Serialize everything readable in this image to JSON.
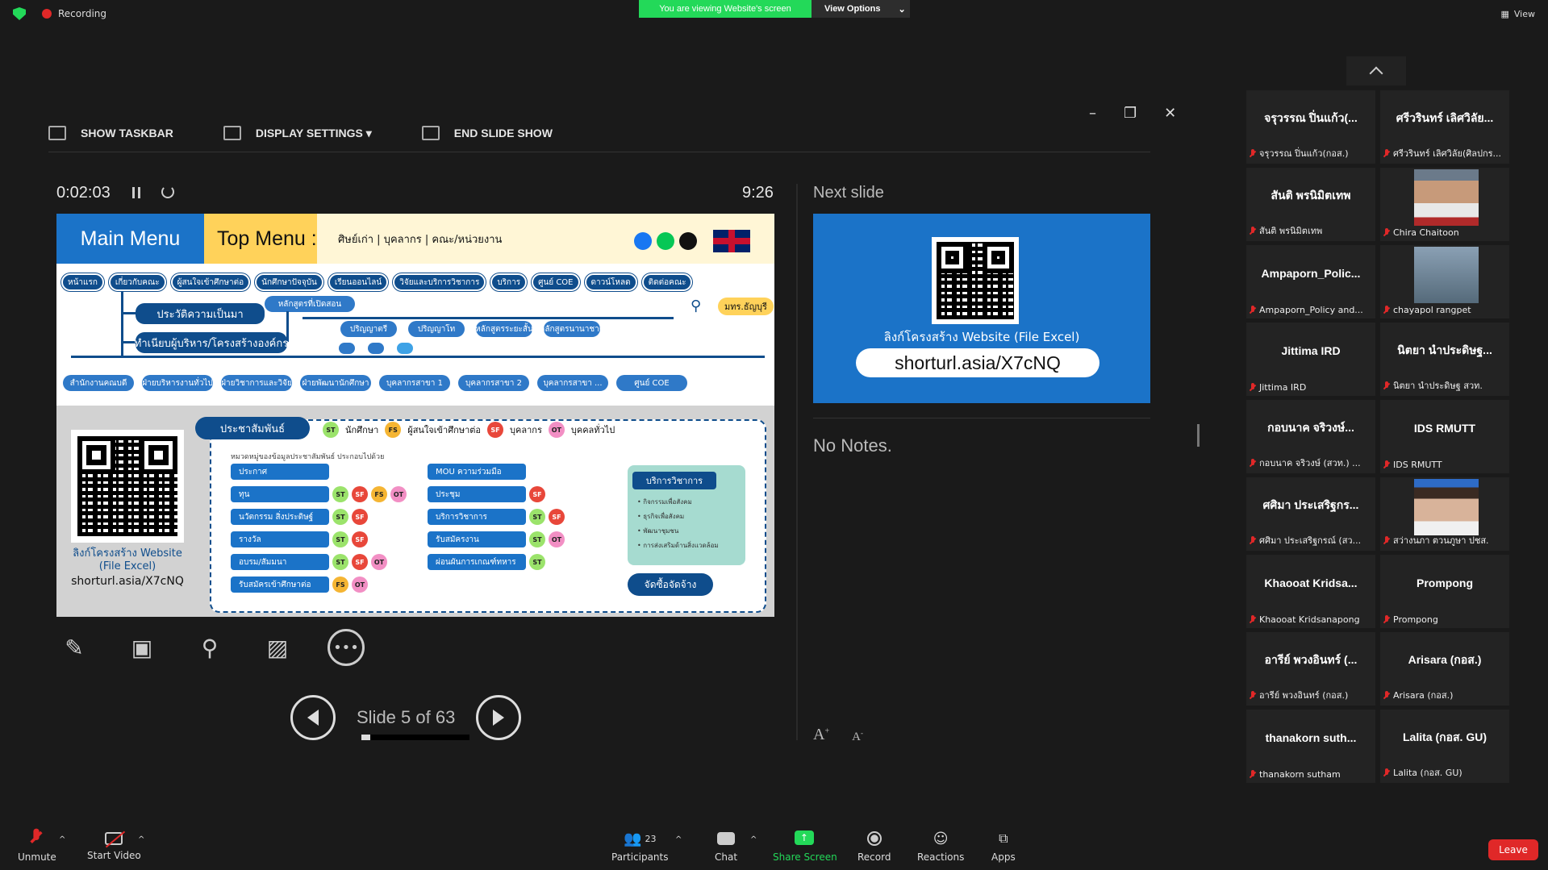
{
  "topbar": {
    "recording_label": "Recording",
    "viewing_banner": "You are viewing Website's screen",
    "view_options": "View Options",
    "view_label": "View"
  },
  "presenter": {
    "toolbar": {
      "show_taskbar": "SHOW TASKBAR",
      "display_settings": "DISPLAY SETTINGS ▾",
      "end_slide_show": "END SLIDE SHOW"
    },
    "timer": "0:02:03",
    "clock": "9:26",
    "slide_counter": "Slide 5 of 63",
    "progress_fraction": 0.079,
    "next_slide_label": "Next slide",
    "notes": "No Notes.",
    "font_increase": "A",
    "font_decrease": "A"
  },
  "slide": {
    "main_menu": "Main Menu",
    "top_menu": "Top Menu :",
    "top_links": "ศิษย์เก่า | บุคลากร | คณะ/หน่วยงาน",
    "nav": [
      "หน้าแรก",
      "เกี่ยวกับคณะ",
      "ผู้สนใจเข้าศึกษาต่อ",
      "นักศึกษาปัจจุบัน",
      "เรียนออนไลน์",
      "วิจัยและบริการวิชาการ",
      "บริการ",
      "ศูนย์ COE",
      "ดาวน์โหลด",
      "ติดต่อคณะ"
    ],
    "history": "ประวัติความเป็นมา",
    "courses": "หลักสูตรที่เปิดสอน",
    "course_levels": [
      "ปริญญาตรี",
      "ปริญญาโท",
      "หลักสูตรระยะสั้น",
      "หลักสูตรนานาชาติ"
    ],
    "admin": "ทำเนียบผู้บริหาร/โครงสร้างองค์กร",
    "units": [
      "สำนักงานคณบดี",
      "ฝ่ายบริหารงานทั่วไป",
      "ฝ่ายวิชาการและวิจัย",
      "ฝ่ายพัฒนานักศึกษา",
      "บุคลากรสาขา 1",
      "บุคลากรสาขา 2",
      "บุคลากรสาขา ...",
      "ศูนย์ COE"
    ],
    "campus_badge": "มทร.ธัญบุรี",
    "qr_caption": "ลิงก์โครงสร้าง Website (File Excel)",
    "qr_url": "shorturl.asia/X7cNQ",
    "pr_header": "ประชาสัมพันธ์",
    "legend": [
      {
        "code": "ST",
        "label": "นักศึกษา"
      },
      {
        "code": "FS",
        "label": "ผู้สนใจเข้าศึกษาต่อ"
      },
      {
        "code": "SF",
        "label": "บุคลากร"
      },
      {
        "code": "OT",
        "label": "บุคคลทั่วไป"
      }
    ],
    "pr_note": "หมวดหมู่ของข้อมูลประชาสัมพันธ์ ประกอบไปด้วย",
    "categories_left": [
      {
        "label": "ประกาศ",
        "badges": []
      },
      {
        "label": "ทุน",
        "badges": [
          "ST",
          "SF",
          "FS",
          "OT"
        ]
      },
      {
        "label": "นวัตกรรม สิ่งประดิษฐ์",
        "badges": [
          "ST",
          "SF"
        ]
      },
      {
        "label": "รางวัล",
        "badges": [
          "ST",
          "SF"
        ]
      },
      {
        "label": "อบรม/สัมมนา",
        "badges": [
          "ST",
          "SF",
          "OT"
        ]
      },
      {
        "label": "รับสมัครเข้าศึกษาต่อ",
        "badges": [
          "FS",
          "OT"
        ]
      }
    ],
    "categories_right": [
      {
        "label": "MOU ความร่วมมือ",
        "badges": []
      },
      {
        "label": "ประชุม",
        "badges": [
          "SF"
        ]
      },
      {
        "label": "บริการวิชาการ",
        "badges": [
          "ST",
          "SF"
        ]
      },
      {
        "label": "รับสมัครงาน",
        "badges": [
          "ST",
          "OT"
        ]
      },
      {
        "label": "ผ่อนผันการเกณฑ์ทหาร",
        "badges": [
          "ST"
        ]
      }
    ],
    "service_head": "บริการวิชาการ",
    "service_items": [
      "กิจกรรมเพื่อสังคม",
      "ธุรกิจเพื่อสังคม",
      "พัฒนาชุมชน",
      "การส่งเสริมด้านสิ่งแวดล้อม"
    ],
    "procurement": "จัดซื้อจัดจ้าง"
  },
  "next_slide": {
    "caption": "ลิงก์โครงสร้าง Website  (File Excel)",
    "url": "shorturl.asia/X7cNQ"
  },
  "participants": [
    {
      "name": "จรุวรรณ ปิ่นแก้ว(...",
      "sub": "จรุวรรณ ปิ่นแก้ว(กอส.)",
      "photo": null
    },
    {
      "name": "ศรีวรินทร์ เลิศวิลัย...",
      "sub": "ศรีวรินทร์ เลิศวิลัย(ศิลปกร...",
      "photo": null
    },
    {
      "name": "สันติ พรนิมิตเทพ",
      "sub": "สันติ พรนิมิตเทพ",
      "photo": null
    },
    {
      "name": "",
      "sub": "Chira Chaitoon",
      "photo": "face"
    },
    {
      "name": "Ampaporn_Polic...",
      "sub": "Ampaporn_Policy and...",
      "photo": null
    },
    {
      "name": "",
      "sub": "chayapol rangpet",
      "photo": "tower"
    },
    {
      "name": "Jittima IRD",
      "sub": "Jittima IRD",
      "photo": null
    },
    {
      "name": "นิตยา นำประดิษฐ...",
      "sub": "นิตยา นำประดิษฐ สวท.",
      "photo": null
    },
    {
      "name": "กอบนาค จริวงษ์...",
      "sub": "กอบนาค จริวงษ์ (สวท.) ...",
      "photo": null
    },
    {
      "name": "IDS RMUTT",
      "sub": "IDS RMUTT",
      "photo": null
    },
    {
      "name": "ศศิมา ประเสริฐกร...",
      "sub": "ศศิมา ประเสริฐกรณ์ (สว...",
      "photo": null
    },
    {
      "name": "",
      "sub": "สว่างนภา ตวนภูษา ปชส.",
      "photo": "woman"
    },
    {
      "name": "Khaooat  Kridsa...",
      "sub": "Khaooat Kridsanapong",
      "photo": null
    },
    {
      "name": "Prompong",
      "sub": "Prompong",
      "photo": null
    },
    {
      "name": "อารีย์ พวงอินทร์ (...",
      "sub": "อารีย์ พวงอินทร์ (กอส.)",
      "photo": null
    },
    {
      "name": "Arisara (กอส.)",
      "sub": "Arisara (กอส.)",
      "photo": null
    },
    {
      "name": "thanakorn  suth...",
      "sub": "thanakorn  sutham",
      "photo": null
    },
    {
      "name": "Lalita (กอส. GU)",
      "sub": "Lalita (กอส. GU)",
      "photo": null
    }
  ],
  "bottombar": {
    "unmute": "Unmute",
    "start_video": "Start Video",
    "participants": "Participants",
    "participant_count": "23",
    "chat": "Chat",
    "share_screen": "Share Screen",
    "record": "Record",
    "reactions": "Reactions",
    "apps": "Apps",
    "leave": "Leave"
  },
  "colors": {
    "green": "#23d959",
    "blue": "#1b73c8",
    "navy": "#0f4d8c",
    "red": "#e02828",
    "yellow": "#ffd25a"
  }
}
